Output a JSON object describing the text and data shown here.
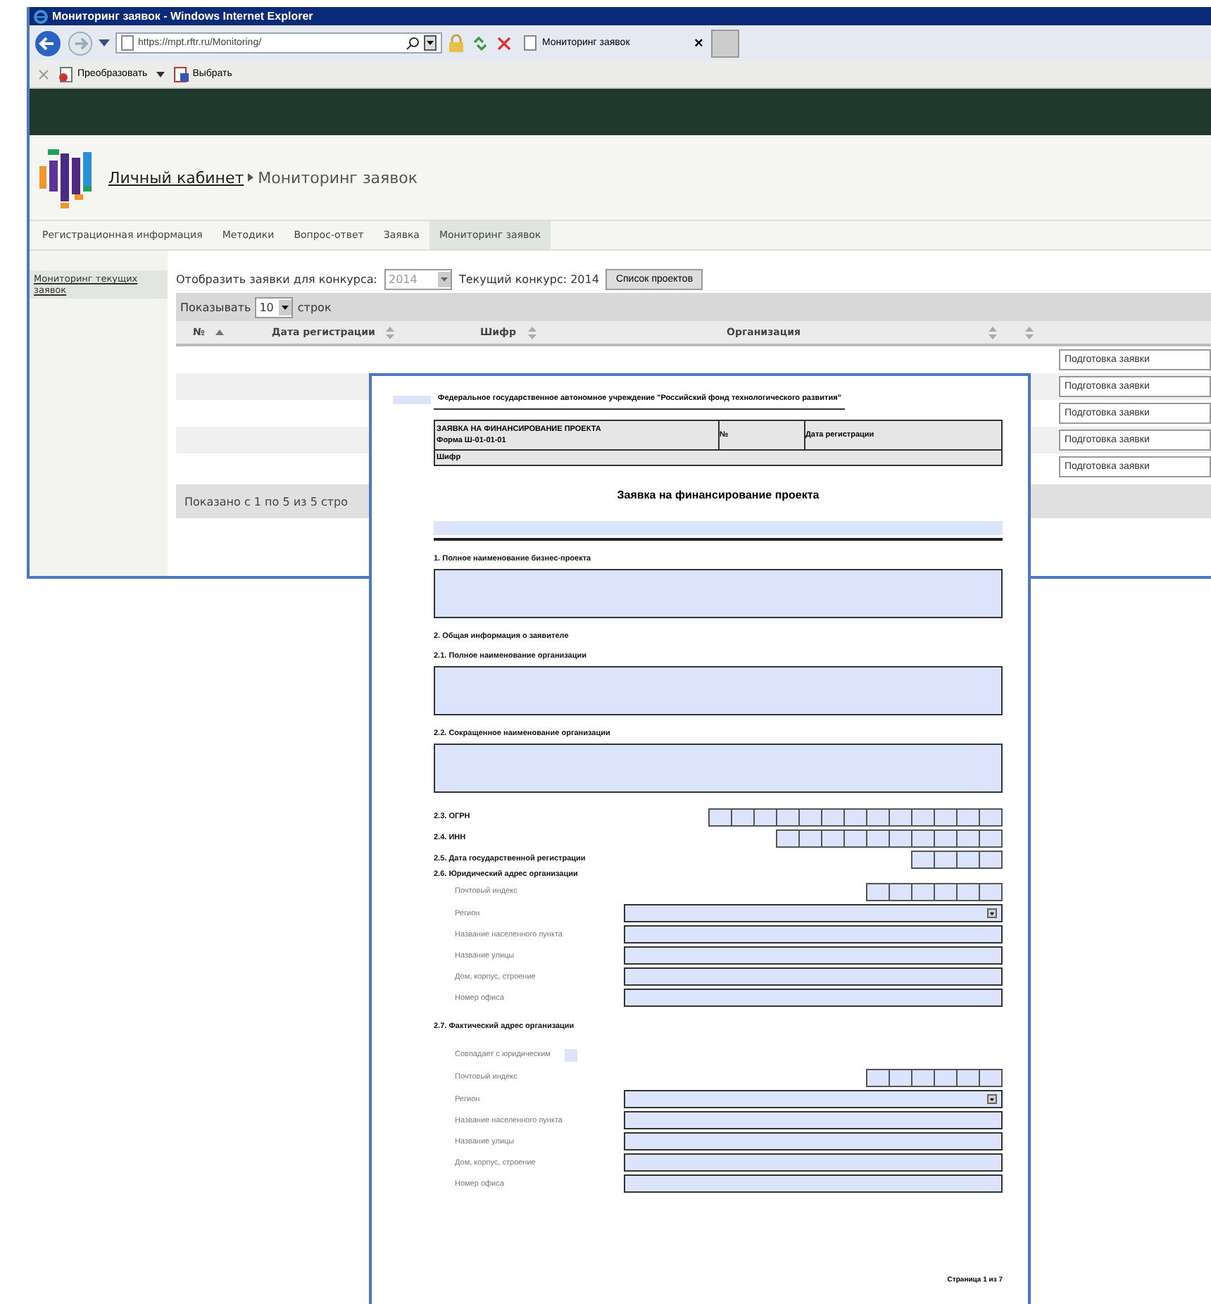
{
  "browser": {
    "title": "Мониторинг заявок - Windows Internet Explorer",
    "address": "https://mpt.rftr.ru/Monitoring/",
    "tab": "Мониторинг заявок",
    "tab_close": "×",
    "commands": [
      "Преобразовать",
      "Выбрать"
    ]
  },
  "site": {
    "breadcrumb_link": "Личный кабинет",
    "breadcrumb_current": "Мониторинг заявок",
    "nav": [
      {
        "label": "Регистрационная информация",
        "selected": false
      },
      {
        "label": "Методики",
        "selected": false
      },
      {
        "label": "Вопрос-ответ",
        "selected": false
      },
      {
        "label": "Заявка",
        "selected": false
      },
      {
        "label": "Мониторинг заявок",
        "selected": true
      }
    ],
    "sidebar": [
      {
        "label": "Мониторинг текущих заявок",
        "selected": true
      }
    ],
    "filter": {
      "label": "Отобразить заявки для конкурса:",
      "year": "2014",
      "current": "Текущий конкурс: 2014",
      "button": "Список проектов"
    },
    "table": {
      "show_prefix": "Показывать",
      "page_size": "10",
      "show_suffix": "строк",
      "columns": [
        {
          "label": "№",
          "kind": "ascending"
        },
        {
          "label": "Дата регистрации",
          "kind": "sortable"
        },
        {
          "label": "Шифр",
          "kind": "sortable"
        },
        {
          "label": "Организация",
          "kind": "sortable"
        },
        {
          "kind": "sortable"
        },
        {
          "kind": "plain"
        }
      ],
      "rows": [
        {
          "status": "Подготовка заявки"
        },
        {
          "status": "Подготовка заявки"
        },
        {
          "status": "Подготовка заявки"
        },
        {
          "status": "Подготовка заявки"
        },
        {
          "status": "Подготовка заявки"
        }
      ],
      "info": "Показано с 1 по 5 из 5 стро"
    }
  },
  "document": {
    "organization": "Федеральное государственное автономное учреждение \"Российский фонд технологического развития\"",
    "form_title": "ЗАЯВКА НА ФИНАНСИРОВАНИЕ ПРОЕКТА",
    "form_code": "Форма Ш-01-01-01",
    "number_label": "№",
    "date_label": "Дата регистрации",
    "code_label": "Шифр",
    "heading": "Заявка на финансирование проекта",
    "items": [
      {
        "kind": "area",
        "label": "1. Полное наименование бизнес-проекта"
      },
      {
        "kind": "heading",
        "label": "2. Общая информация о заявителе"
      },
      {
        "kind": "area",
        "label": "2.1. Полное наименование организации"
      },
      {
        "kind": "area",
        "label": "2.2. Сокращенное наименование организации"
      },
      {
        "kind": "ogrn",
        "label": "2.3. ОГРН"
      },
      {
        "kind": "inn",
        "label": "2.4. ИНН"
      },
      {
        "kind": "date",
        "label": "2.5. Дата государственной регистрации"
      },
      {
        "kind": "heading",
        "label": "2.6. Юридический адрес организации"
      },
      {
        "kind": "postcode",
        "label": "Почтовый индекс"
      },
      {
        "kind": "select",
        "label": "Регион"
      },
      {
        "kind": "field",
        "label": "Название населенного пункта"
      },
      {
        "kind": "field",
        "label": "Название улицы"
      },
      {
        "kind": "field",
        "label": "Дом, корпус, строение"
      },
      {
        "kind": "field",
        "label": "Номер офиса"
      },
      {
        "kind": "heading",
        "label": "2.7. Фактический адрес организации"
      },
      {
        "kind": "checkbox",
        "label": "Совпадает с юридическим",
        "checked": false
      },
      {
        "kind": "postcode",
        "label": "Почтовый индекс"
      },
      {
        "kind": "select",
        "label": "Регион"
      },
      {
        "kind": "field",
        "label": "Название населенного пункта"
      },
      {
        "kind": "field",
        "label": "Название улицы"
      },
      {
        "kind": "field",
        "label": "Дом, корпус, строение"
      },
      {
        "kind": "field",
        "label": "Номер офиса"
      }
    ],
    "page": "Страница 1 из 7"
  }
}
